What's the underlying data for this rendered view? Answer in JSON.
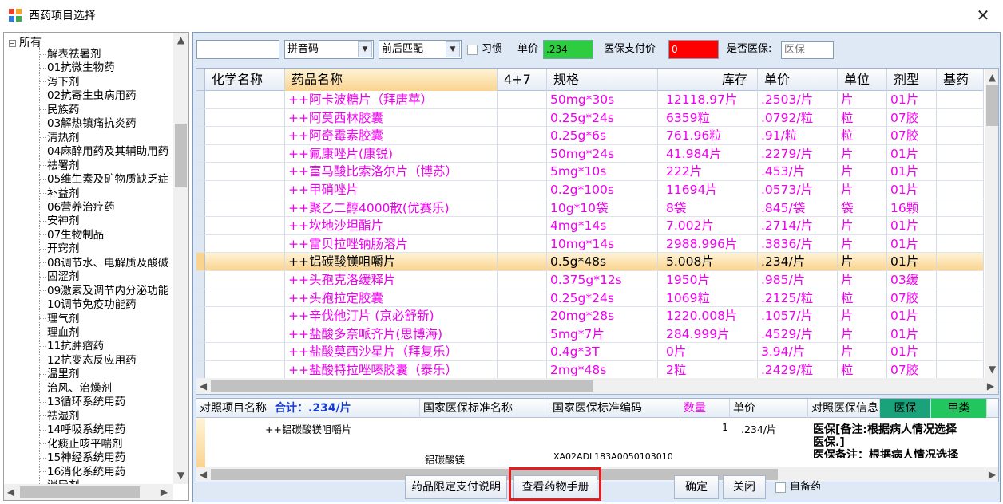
{
  "window": {
    "title": "西药项目选择",
    "close_glyph": "✕",
    "icon": "app-grid-icon"
  },
  "tree": {
    "root": {
      "label": "所有",
      "expander": "−"
    },
    "items": [
      "解表祛暑剂",
      "01抗微生物药",
      "泻下剂",
      "02抗寄生虫病用药",
      "民族药",
      "03解热镇痛抗炎药",
      "清热剂",
      "04麻醉用药及其辅助用药",
      "祛署剂",
      "05维生素及矿物质缺乏症",
      "补益剂",
      "06营养治疗药",
      "安神剂",
      "07生物制品",
      "开窍剂",
      "08调节水、电解质及酸碱",
      "固涩剂",
      "09激素及调节内分泌功能",
      "10调节免疫功能药",
      "理气剂",
      "理血剂",
      "11抗肿瘤药",
      "12抗变态反应用药",
      "温里剂",
      "治风、治燥剂",
      "13循环系统用药",
      "祛湿剂",
      "14呼吸系统用药",
      "化痰止咳平喘剂",
      "15神经系统用药",
      "16消化系统用药",
      "消导剂"
    ]
  },
  "toolbar": {
    "search_value": "",
    "mode_value": "拼音码",
    "match_value": "前后匹配",
    "habit_label": "习惯",
    "price_label": "单价",
    "price_value": ".234",
    "price_color": "#2ecc40",
    "insurance_pay_label": "医保支付价",
    "insurance_pay_value": "0",
    "insurance_pay_color": "#ff0000",
    "is_insurance_label": "是否医保:",
    "is_insurance_value": "医保"
  },
  "grid": {
    "columns": [
      "化学名称",
      "药品名称",
      "4+7",
      "规格",
      "库存",
      "单价",
      "单位",
      "剂型",
      "基药"
    ],
    "rows": [
      {
        "chem": "",
        "name": "++阿卡波糖片（拜唐苹）",
        "g47": "",
        "spec": "50mg*30s",
        "stock": "12118.97片",
        "price": ".2503/片",
        "unit": "片",
        "form": "01片",
        "base": ""
      },
      {
        "chem": "",
        "name": "++阿莫西林胶囊",
        "g47": "",
        "spec": "0.25g*24s",
        "stock": "6359粒",
        "price": ".0792/粒",
        "unit": "粒",
        "form": "07胶",
        "base": ""
      },
      {
        "chem": "",
        "name": "++阿奇霉素胶囊",
        "g47": "",
        "spec": "0.25g*6s",
        "stock": "761.96粒",
        "price": ".91/粒",
        "unit": "粒",
        "form": "07胶",
        "base": ""
      },
      {
        "chem": "",
        "name": "++氟康唑片(康锐)",
        "g47": "",
        "spec": "50mg*24s",
        "stock": "41.984片",
        "price": ".2279/片",
        "unit": "片",
        "form": "01片",
        "base": ""
      },
      {
        "chem": "",
        "name": "++富马酸比索洛尔片（博苏）",
        "g47": "",
        "spec": "5mg*10s",
        "stock": "222片",
        "price": ".453/片",
        "unit": "片",
        "form": "01片",
        "base": ""
      },
      {
        "chem": "",
        "name": "++甲硝唑片",
        "g47": "",
        "spec": "0.2g*100s",
        "stock": "11694片",
        "price": ".0573/片",
        "unit": "片",
        "form": "01片",
        "base": ""
      },
      {
        "chem": "",
        "name": "++聚乙二醇4000散(优赛乐)",
        "g47": "",
        "spec": "10g*10袋",
        "stock": "8袋",
        "price": ".845/袋",
        "unit": "袋",
        "form": "16颗",
        "base": ""
      },
      {
        "chem": "",
        "name": "++坎地沙坦酯片",
        "g47": "",
        "spec": "4mg*14s",
        "stock": "7.002片",
        "price": ".2714/片",
        "unit": "片",
        "form": "01片",
        "base": ""
      },
      {
        "chem": "",
        "name": "++雷贝拉唑钠肠溶片",
        "g47": "",
        "spec": "10mg*14s",
        "stock": "2988.996片",
        "price": ".3836/片",
        "unit": "片",
        "form": "01片",
        "base": ""
      },
      {
        "chem": "",
        "name": "++铝碳酸镁咀嚼片",
        "g47": "",
        "spec": "0.5g*48s",
        "stock": "5.008片",
        "price": ".234/片",
        "unit": "片",
        "form": "01片",
        "base": "",
        "selected": true
      },
      {
        "chem": "",
        "name": "++头孢克洛缓释片",
        "g47": "",
        "spec": "0.375g*12s",
        "stock": "1950片",
        "price": ".985/片",
        "unit": "片",
        "form": "03缓",
        "base": ""
      },
      {
        "chem": "",
        "name": "++头孢拉定胶囊",
        "g47": "",
        "spec": "0.25g*24s",
        "stock": "1069粒",
        "price": ".2125/粒",
        "unit": "粒",
        "form": "07胶",
        "base": ""
      },
      {
        "chem": "",
        "name": "++辛伐他汀片 (京必舒新)",
        "g47": "",
        "spec": "20mg*28s",
        "stock": "1220.008片",
        "price": ".1057/片",
        "unit": "片",
        "form": "01片",
        "base": ""
      },
      {
        "chem": "",
        "name": "++盐酸多奈哌齐片(思博海)",
        "g47": "",
        "spec": "5mg*7片",
        "stock": "284.999片",
        "price": ".4529/片",
        "unit": "片",
        "form": "01片",
        "base": ""
      },
      {
        "chem": "",
        "name": "++盐酸莫西沙星片（拜复乐）",
        "g47": "",
        "spec": "0.4g*3T",
        "stock": "0片",
        "price": "3.94/片",
        "unit": "片",
        "form": "01片",
        "base": ""
      },
      {
        "chem": "",
        "name": "++盐酸特拉唑嗪胶囊（泰乐）",
        "g47": "",
        "spec": "2mg*48s",
        "stock": "2粒",
        "price": ".2429/粒",
        "unit": "粒",
        "form": "07胶",
        "base": ""
      }
    ]
  },
  "detail": {
    "headers": {
      "item_name": "对照项目名称",
      "total": "合计：.234/片",
      "nat_name": "国家医保标准名称",
      "nat_code": "国家医保标准编码",
      "qty": "数量",
      "price": "单价",
      "info": "对照医保信息",
      "badge1": "医保",
      "badge2": "甲类"
    },
    "badge1_color": "#1aa37a",
    "badge2_color": "#22c55e",
    "row": {
      "item_name": "++铝碳酸镁咀嚼片",
      "nat_name": "铝碳酸镁",
      "nat_code": "XA02ADL183A0050103010",
      "qty": "1",
      "price": ".234/片",
      "info1": "医保[备注:根据病人情况选择",
      "info2": "医保.]",
      "info3": "医保备注：根据病人情况选择"
    }
  },
  "footer": {
    "limit_btn": "药品限定支付说明",
    "manual_btn": "查看药物手册",
    "ok_btn": "确定",
    "close_btn": "关闭",
    "self_label": "自备药",
    "highlight_color": "#e02020"
  }
}
